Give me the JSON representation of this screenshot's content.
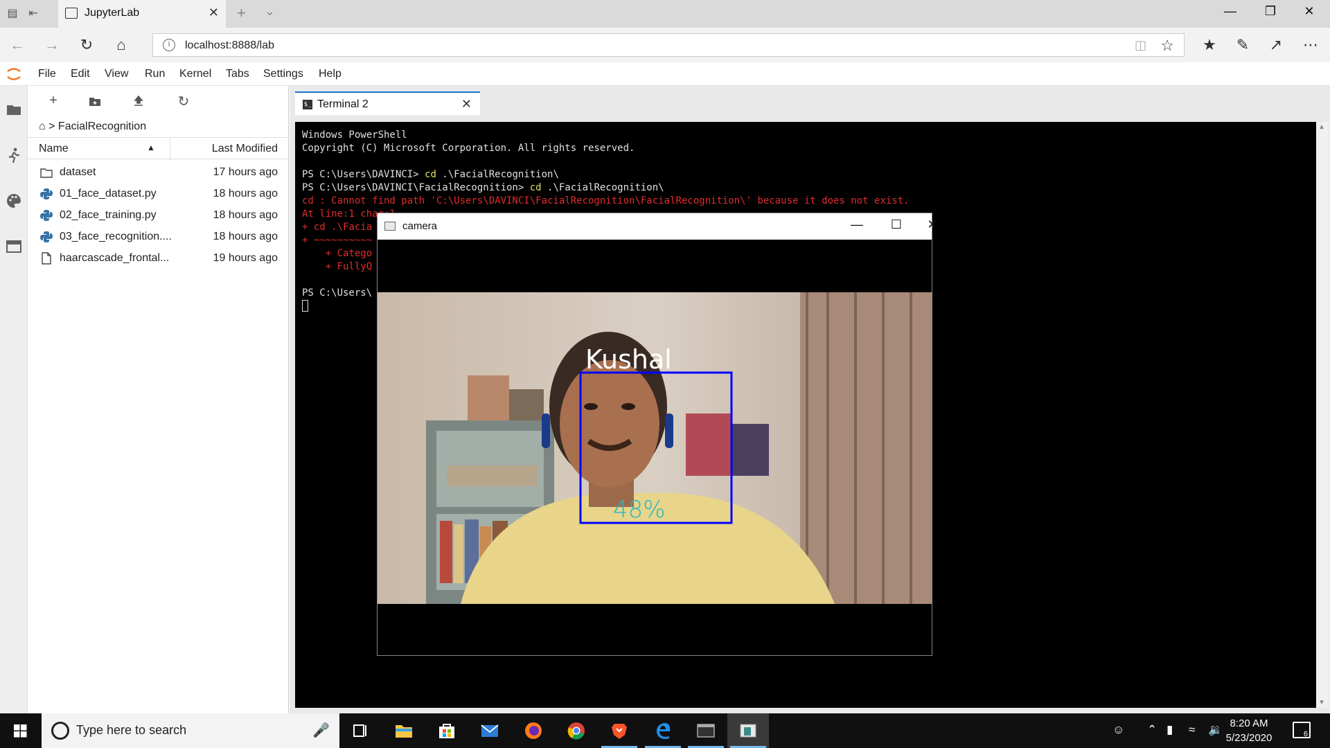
{
  "browser": {
    "tab_title": "JupyterLab",
    "url": "localhost:8888/lab"
  },
  "jupyter": {
    "menu": [
      "File",
      "Edit",
      "View",
      "Run",
      "Kernel",
      "Tabs",
      "Settings",
      "Help"
    ],
    "breadcrumb": "FacialRecognition",
    "columns": {
      "name": "Name",
      "modified": "Last Modified"
    },
    "files": [
      {
        "name": "dataset",
        "type": "folder",
        "modified": "17 hours ago"
      },
      {
        "name": "01_face_dataset.py",
        "type": "python",
        "modified": "18 hours ago"
      },
      {
        "name": "02_face_training.py",
        "type": "python",
        "modified": "18 hours ago"
      },
      {
        "name": "03_face_recognition....",
        "type": "python",
        "modified": "18 hours ago"
      },
      {
        "name": "haarcascade_frontal...",
        "type": "file",
        "modified": "19 hours ago"
      }
    ],
    "doc_tab": "Terminal 2"
  },
  "terminal": {
    "lines": [
      {
        "parts": [
          {
            "t": "Windows PowerShell",
            "c": ""
          }
        ]
      },
      {
        "parts": [
          {
            "t": "Copyright (C) Microsoft Corporation. All rights reserved.",
            "c": ""
          }
        ]
      },
      {
        "parts": [
          {
            "t": "",
            "c": ""
          }
        ]
      },
      {
        "parts": [
          {
            "t": "PS C:\\Users\\DAVINCI> ",
            "c": ""
          },
          {
            "t": "cd",
            "c": "yellow"
          },
          {
            "t": " .\\FacialRecognition\\",
            "c": ""
          }
        ]
      },
      {
        "parts": [
          {
            "t": "PS C:\\Users\\DAVINCI\\FacialRecognition> ",
            "c": ""
          },
          {
            "t": "cd",
            "c": "yellow"
          },
          {
            "t": " .\\FacialRecognition\\",
            "c": ""
          }
        ]
      },
      {
        "parts": [
          {
            "t": "cd : Cannot find path 'C:\\Users\\DAVINCI\\FacialRecognition\\FacialRecognition\\' because it does not exist.",
            "c": "red"
          }
        ]
      },
      {
        "parts": [
          {
            "t": "At line:1 char:1",
            "c": "red"
          }
        ]
      },
      {
        "parts": [
          {
            "t": "+ cd .\\Facia",
            "c": "red"
          }
        ]
      },
      {
        "parts": [
          {
            "t": "+ ~~~~~~~~~~",
            "c": "red"
          }
        ]
      },
      {
        "parts": [
          {
            "t": "    + Catego                                                                   n], ItemNotFoundException",
            "c": "red"
          }
        ]
      },
      {
        "parts": [
          {
            "t": "    + FullyQ",
            "c": "red"
          }
        ]
      },
      {
        "parts": [
          {
            "t": "",
            "c": ""
          }
        ]
      },
      {
        "parts": [
          {
            "t": "PS C:\\Users\\",
            "c": ""
          }
        ]
      }
    ]
  },
  "camera": {
    "title": "camera",
    "name_label": "Kushal",
    "confidence": "48%"
  },
  "taskbar": {
    "search_placeholder": "Type here to search",
    "time": "8:20 AM",
    "date": "5/23/2020",
    "notifications": "6"
  },
  "colors": {
    "accent": "#1976d2",
    "terminal_red": "#e12d2d",
    "terminal_yellow": "#e5e05a",
    "face_box": "#0000ff",
    "confidence": "#29b6c8"
  }
}
